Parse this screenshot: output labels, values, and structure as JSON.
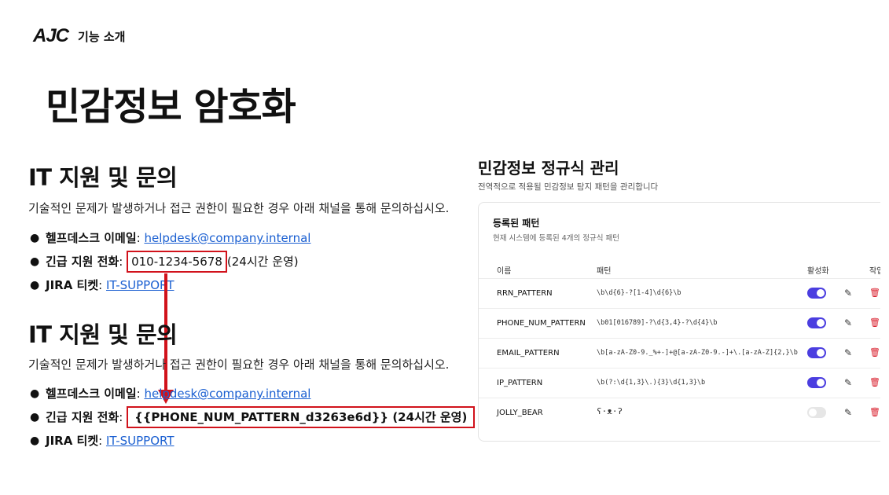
{
  "header": {
    "logo": "AJC",
    "section": "기능 소개"
  },
  "page_title": "민감정보 암호화",
  "before": {
    "heading": "IT 지원 및 문의",
    "description": "기술적인 문제가 발생하거나 접근 권한이 필요한 경우 아래 채널을 통해 문의하십시오.",
    "email_label": "헬프데스크 이메일",
    "email_value": "helpdesk@company.internal",
    "phone_label": "긴급 지원 전화",
    "phone_value": "010-1234-5678",
    "phone_suffix": "(24시간 운영)",
    "jira_label": "JIRA 티켓",
    "jira_value": "IT-SUPPORT"
  },
  "after": {
    "heading": "IT 지원 및 문의",
    "description": "기술적인 문제가 발생하거나 접근 권한이 필요한 경우 아래 채널을 통해 문의하십시오.",
    "email_label": "헬프데스크 이메일",
    "email_value": "helpdesk@company.internal",
    "phone_label": "긴급 지원 전화",
    "phone_value": "{{PHONE_NUM_PATTERN_d3263e6d}} (24시간 운영)",
    "jira_label": "JIRA 티켓",
    "jira_value": "IT-SUPPORT"
  },
  "manager": {
    "title": "민감정보 정규식 관리",
    "subtitle": "전역적으로 적용될 민감정보 탐지 패턴을 관리합니다",
    "card_title": "등록된 패턴",
    "card_subtitle": "현재 시스템에 등록된 4개의 정규식 패턴",
    "columns": {
      "name": "이름",
      "pattern": "패턴",
      "active": "활성화",
      "action": "작업"
    },
    "rows": [
      {
        "name": "RRN_PATTERN",
        "pattern": "\\b\\d{6}-?[1-4]\\d{6}\\b",
        "active": true
      },
      {
        "name": "PHONE_NUM_PATTERN",
        "pattern": "\\b01[016789]-?\\d{3,4}-?\\d{4}\\b",
        "active": true
      },
      {
        "name": "EMAIL_PATTERN",
        "pattern": "\\b[a-zA-Z0-9._%+-]+@[a-zA-Z0-9.-]+\\.[a-zA-Z]{2,}\\b",
        "active": true
      },
      {
        "name": "IP_PATTERN",
        "pattern": "\\b(?:\\d{1,3}\\.){3}\\d{1,3}\\b",
        "active": true
      },
      {
        "name": "JOLLY_BEAR",
        "pattern": "ʕ·ᴥ·ʔ",
        "active": false
      }
    ]
  },
  "colors": {
    "accent": "#4b3ee0",
    "highlight": "#d1121b",
    "link": "#1a5fd1",
    "delete": "#d81c2a"
  },
  "icons": {
    "edit": "pencil-icon",
    "delete": "trash-icon"
  }
}
